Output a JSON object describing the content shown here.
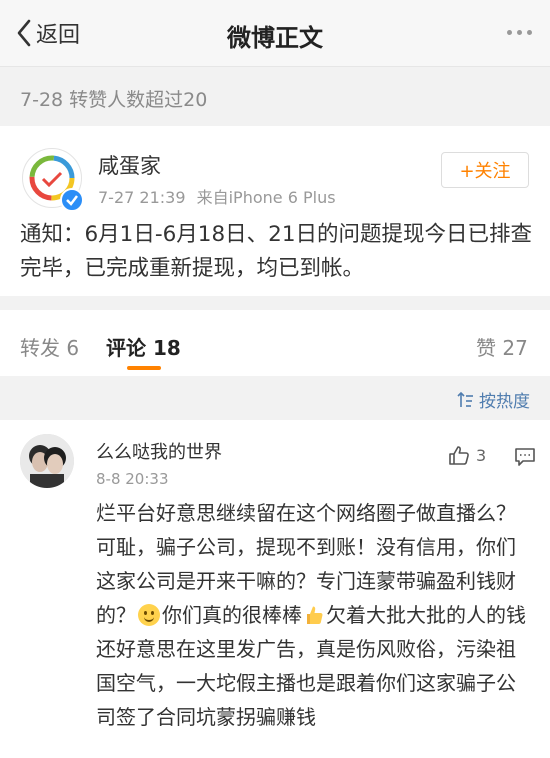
{
  "nav": {
    "back_label": "返回",
    "title": "微博正文"
  },
  "repost_notice": "7-28 转赞人数超过20",
  "post": {
    "author": "咸蛋家",
    "time": "7-27 21:39",
    "source": "来自iPhone 6 Plus",
    "follow_label": "+关注",
    "text": "通知：6月1日-6月18日、21日的问题提现今日已排查完毕，已完成重新提现，均已到帐。"
  },
  "tabs": {
    "repost": "转发 6",
    "comment": "评论 18",
    "like": "赞 27"
  },
  "sort_label": "按热度",
  "comment": {
    "author": "么么哒我的世界",
    "time": "8-8 20:33",
    "like_count": "3",
    "text_part1": "烂平台好意思继续留在这个网络圈子做直播么？可耻，骗子公司，提现不到账！没有信用，你们这家公司是开来干嘛的？专门连蒙带骗盈利钱财的？",
    "text_part2": "你们真的很棒棒",
    "text_part3": "欠着大批大批的人的钱还好意思在这里发广告，真是伤风败俗，污染祖国空气，一大坨假主播也是跟着你们这家骗子公司签了合同坑蒙拐骗赚钱"
  },
  "colors": {
    "accent": "#ff8200",
    "link": "#507daf",
    "verified": "#2b8ef7"
  }
}
